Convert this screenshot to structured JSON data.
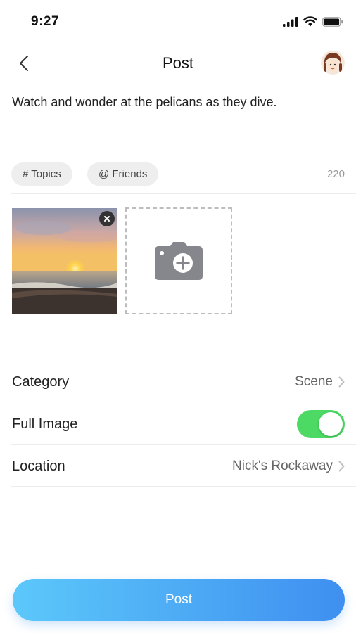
{
  "status_bar": {
    "time": "9:27"
  },
  "nav": {
    "title": "Post"
  },
  "post": {
    "text": "Watch and wonder at the pelicans as they dive."
  },
  "chips": {
    "topics": "# Topics",
    "friends": "@ Friends",
    "char_count": "220"
  },
  "settings": {
    "category": {
      "label": "Category",
      "value": "Scene"
    },
    "full_image": {
      "label": "Full Image",
      "enabled": true
    },
    "location": {
      "label": "Location",
      "value": "Nick's Rockaway"
    }
  },
  "actions": {
    "post_label": "Post"
  },
  "colors": {
    "toggle_on": "#4cd964",
    "button_start": "#5cc8fa",
    "button_end": "#3f8ff0"
  }
}
